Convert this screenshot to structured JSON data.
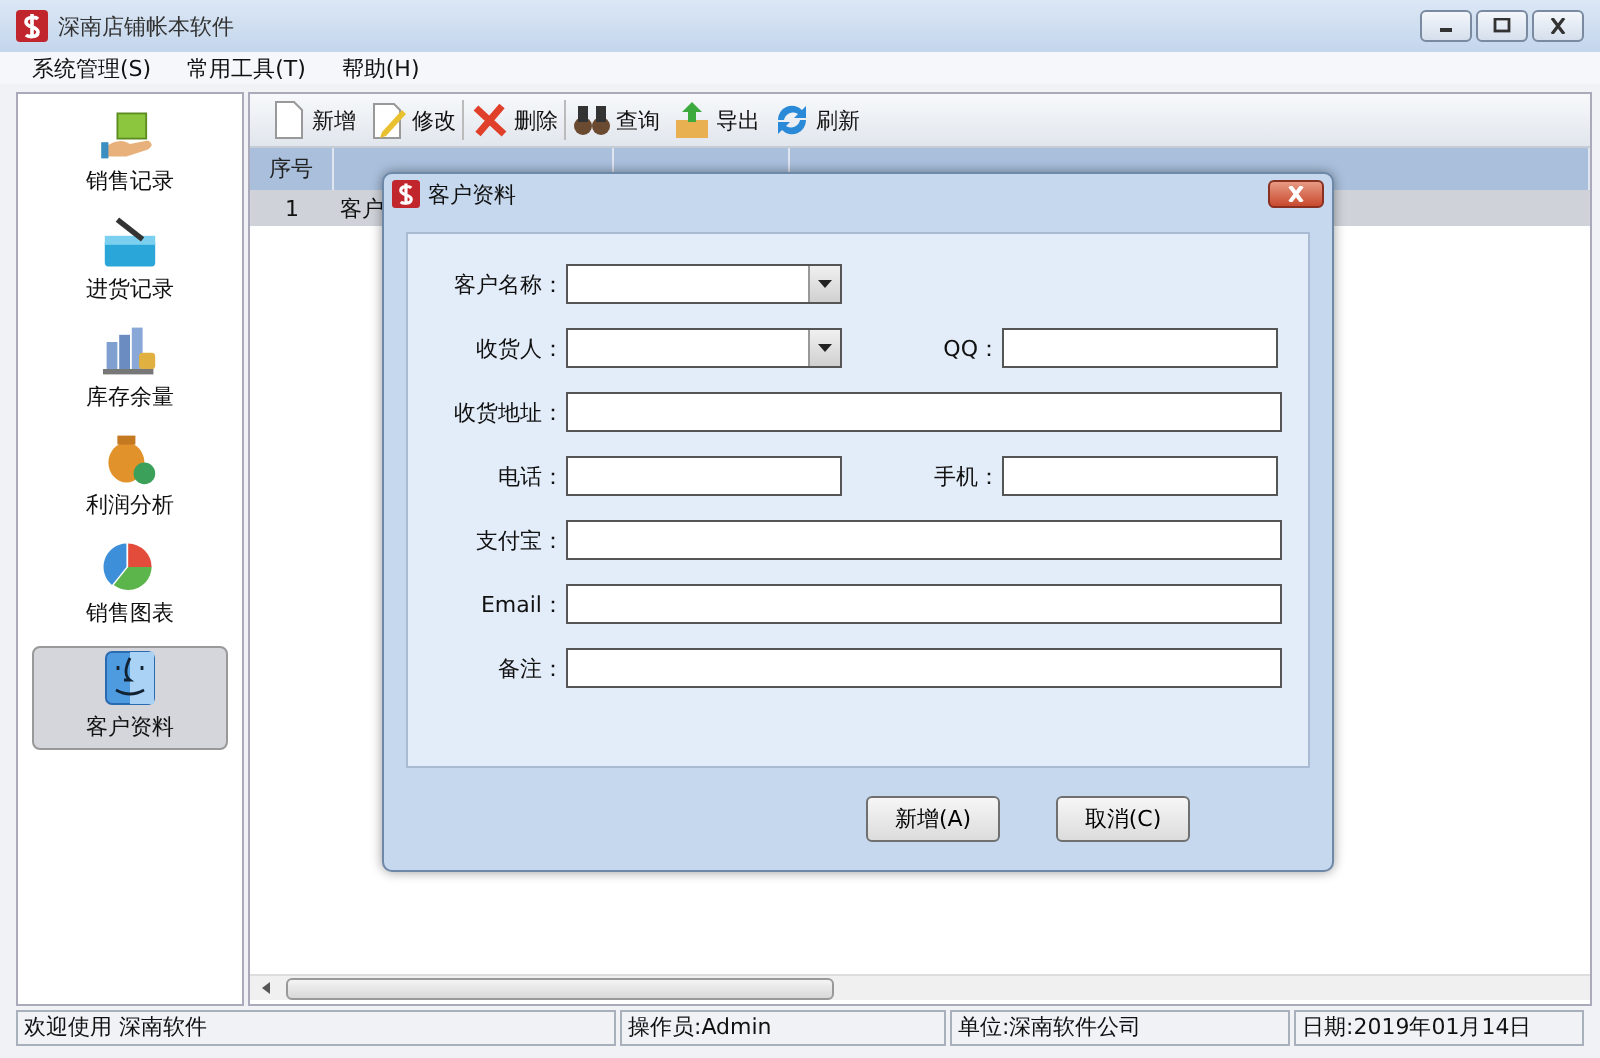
{
  "window": {
    "title": "深南店铺帐本软件"
  },
  "menu": [
    {
      "label": "系统管理(S)"
    },
    {
      "label": "常用工具(T)"
    },
    {
      "label": "帮助(H)"
    }
  ],
  "sidebar": {
    "items": [
      {
        "label": "销售记录",
        "kind": "sales",
        "selected": false
      },
      {
        "label": "进货记录",
        "kind": "purchase",
        "selected": false
      },
      {
        "label": "库存余量",
        "kind": "stock",
        "selected": false
      },
      {
        "label": "利润分析",
        "kind": "profit",
        "selected": false
      },
      {
        "label": "销售图表",
        "kind": "chart",
        "selected": false
      },
      {
        "label": "客户资料",
        "kind": "customer",
        "selected": true
      }
    ]
  },
  "toolbar": [
    {
      "label": "新增",
      "kind": "new"
    },
    {
      "label": "修改",
      "kind": "edit"
    },
    {
      "label": "删除",
      "kind": "delete"
    },
    {
      "label": "查询",
      "kind": "search"
    },
    {
      "label": "导出",
      "kind": "export"
    },
    {
      "label": "刷新",
      "kind": "refresh"
    }
  ],
  "table": {
    "columns": [
      "序号"
    ],
    "rows": [
      [
        "1",
        "客户"
      ]
    ]
  },
  "dialog": {
    "title": "客户资料",
    "fields": [
      {
        "label": "客户名称：",
        "kind": "combo"
      },
      {
        "label": "收货人：",
        "kind": "combo"
      },
      {
        "label": "QQ：",
        "kind": "text"
      },
      {
        "label": "收货地址：",
        "kind": "wide"
      },
      {
        "label": "电话：",
        "kind": "text"
      },
      {
        "label": "手机：",
        "kind": "text"
      },
      {
        "label": "支付宝：",
        "kind": "wide"
      },
      {
        "label": "Email：",
        "kind": "wide"
      },
      {
        "label": "备注：",
        "kind": "wide"
      }
    ],
    "buttons": [
      "新增(A)",
      "取消(C)"
    ]
  },
  "status_bar": [
    "欢迎使用 深南软件",
    "操作员:Admin",
    "单位:深南软件公司",
    "日期:2019年01月14日"
  ]
}
